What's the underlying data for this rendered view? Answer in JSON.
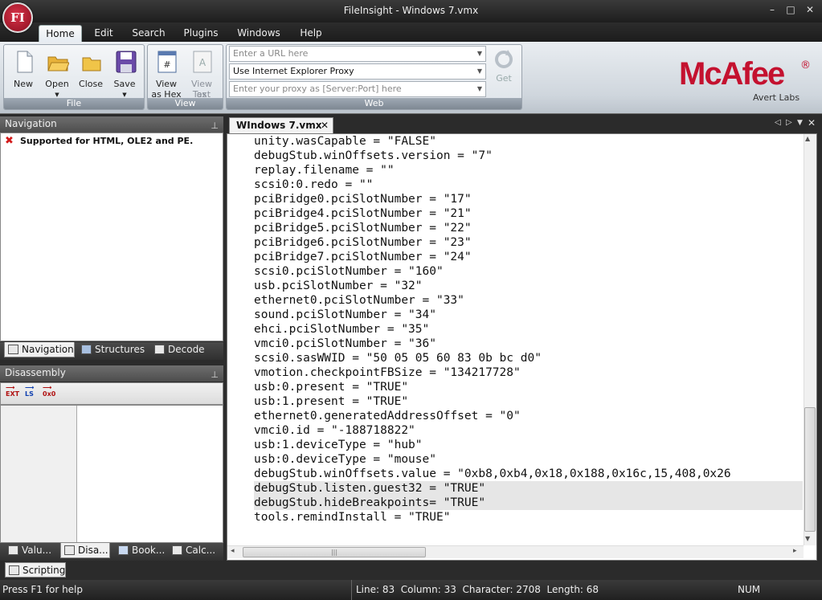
{
  "app": {
    "title": "FileInsight - Windows 7.vmx",
    "logo": "FI"
  },
  "window_controls": {
    "minimize": "–",
    "restore": "□",
    "close": "✕"
  },
  "ribbon_tabs": [
    "Home",
    "Edit",
    "Search",
    "Plugins",
    "Windows",
    "Help"
  ],
  "ribbon": {
    "file_group": {
      "label": "File",
      "buttons": [
        "New",
        "Open",
        "Close",
        "Save"
      ]
    },
    "view_group": {
      "label": "View",
      "hex_line1": "View",
      "hex_line2": "as Hex",
      "text_line1": "View as",
      "text_line2": "Text"
    },
    "web_group": {
      "label": "Web",
      "url_placeholder": "Enter a URL here",
      "proxy_mode": "Use Internet Explorer Proxy",
      "proxy_placeholder": "Enter your proxy as [Server:Port] here",
      "get_label": "Get"
    }
  },
  "brand": {
    "name": "McAfee",
    "reg": "®",
    "sub": "Avert Labs",
    "color": "#c4112f"
  },
  "navigation_panel": {
    "title": "Navigation",
    "message": "Supported for HTML, OLE2 and PE.",
    "tabs": [
      "Navigation",
      "Structures",
      "Decode"
    ]
  },
  "disassembly_panel": {
    "title": "Disassembly",
    "toolbar": [
      "EXT",
      "LS",
      "0x0"
    ],
    "tabs": [
      "Valu...",
      "Disa...",
      "Book...",
      "Calc..."
    ]
  },
  "scripting_tab": "Scripting",
  "document": {
    "tab": "WIndows 7.vmx",
    "lines": [
      "unity.wasCapable = \"FALSE\"",
      "debugStub.winOffsets.version = \"7\"",
      "replay.filename = \"\"",
      "scsi0:0.redo = \"\"",
      "pciBridge0.pciSlotNumber = \"17\"",
      "pciBridge4.pciSlotNumber = \"21\"",
      "pciBridge5.pciSlotNumber = \"22\"",
      "pciBridge6.pciSlotNumber = \"23\"",
      "pciBridge7.pciSlotNumber = \"24\"",
      "scsi0.pciSlotNumber = \"160\"",
      "usb.pciSlotNumber = \"32\"",
      "ethernet0.pciSlotNumber = \"33\"",
      "sound.pciSlotNumber = \"34\"",
      "ehci.pciSlotNumber = \"35\"",
      "vmci0.pciSlotNumber = \"36\"",
      "scsi0.sasWWID = \"50 05 05 60 83 0b bc d0\"",
      "vmotion.checkpointFBSize = \"134217728\"",
      "usb:0.present = \"TRUE\"",
      "usb:1.present = \"TRUE\"",
      "ethernet0.generatedAddressOffset = \"0\"",
      "vmci0.id = \"-188718822\"",
      "usb:1.deviceType = \"hub\"",
      "usb:0.deviceType = \"mouse\"",
      "debugStub.winOffsets.value = \"0xb8,0xb4,0x18,0x188,0x16c,15,408,0x26",
      "debugStub.listen.guest32 = \"TRUE\"",
      "debugStub.hideBreakpoints= \"TRUE\"",
      "tools.remindInstall = \"TRUE\""
    ],
    "selected_lines": [
      24,
      25
    ]
  },
  "status": {
    "help": "Press F1 for help",
    "position": "Line: 83  Column: 33  Character: 2708  Length: 68",
    "num": "NUM"
  }
}
